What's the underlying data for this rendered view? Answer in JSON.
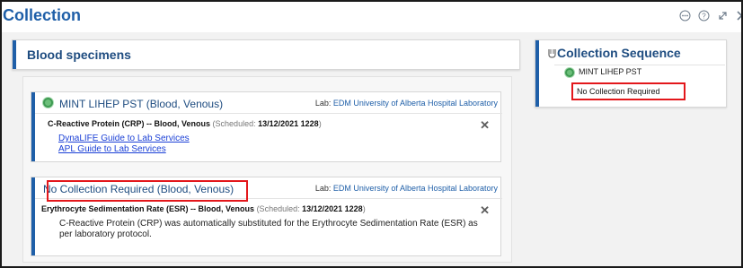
{
  "window": {
    "title": "Collection",
    "icons": [
      "more-options-icon",
      "help-icon",
      "expand-icon",
      "close-icon"
    ]
  },
  "blood_specimens": {
    "header": "Blood specimens",
    "cards": [
      {
        "title": "MINT LIHEP PST (Blood, Venous)",
        "lab_prefix": "Lab:",
        "lab_name": "EDM University of Alberta Hospital Laboratory",
        "order_name": "C-Reactive Protein (CRP) -- Blood, Venous",
        "scheduled_prefix": "(Scheduled:",
        "scheduled_value": "13/12/2021 1228",
        "scheduled_suffix": ")",
        "links": [
          "DynaLIFE Guide to Lab Services",
          "APL Guide to Lab Services"
        ],
        "status_color": "#6cbf7a"
      },
      {
        "title": "No Collection Required (Blood, Venous)",
        "lab_prefix": "Lab:",
        "lab_name": "EDM University of Alberta Hospital Laboratory",
        "order_name": "Erythrocyte Sedimentation Rate (ESR) -- Blood, Venous",
        "scheduled_prefix": "(Scheduled:",
        "scheduled_value": "13/12/2021 1228",
        "scheduled_suffix": ")",
        "note": "C-Reactive Protein (CRP) was automatically substituted for the Erythrocyte Sedimentation Rate (ESR) as per laboratory protocol."
      }
    ]
  },
  "collection_sequence": {
    "title": "Collection Sequence",
    "item": "MINT LIHEP PST",
    "status": "No Collection Required"
  },
  "colors": {
    "accent": "#1f5fa8",
    "highlight": "#e3171b",
    "status_green": "#6cbf7a",
    "link": "#1a3fd6"
  }
}
